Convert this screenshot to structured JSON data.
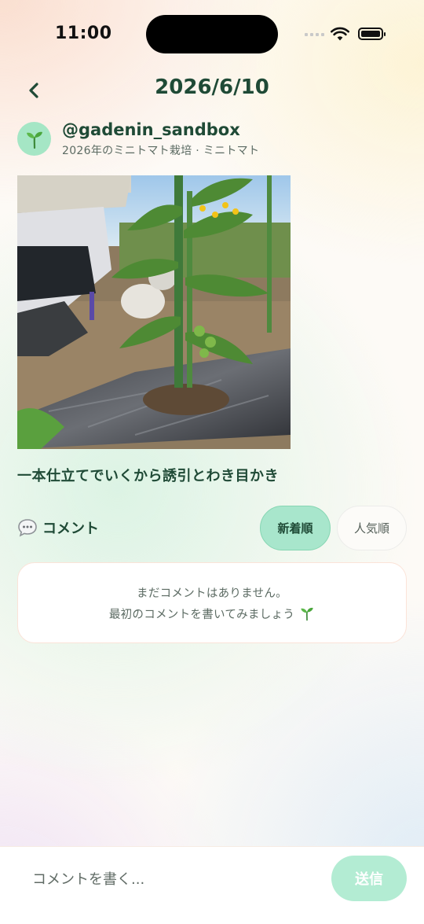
{
  "status_bar": {
    "time": "11:00"
  },
  "header": {
    "title": "2026/6/10",
    "back_icon": "chevron-left-icon"
  },
  "post": {
    "avatar_icon": "seedling-icon",
    "username": "@gadenin_sandbox",
    "subline": "2026年のミニトマト栽培 · ミニトマト",
    "photo_subject": "tomato-seedling-photo",
    "caption": "一本仕立てでいくから誘引とわき目かき"
  },
  "comments": {
    "icon": "speech-bubble-icon",
    "title": "コメント",
    "sort_options": [
      {
        "label": "新着順",
        "selected": true
      },
      {
        "label": "人気順",
        "selected": false
      }
    ],
    "empty_line1": "まだコメントはありません。",
    "empty_line2": "最初のコメントを書いてみましょう"
  },
  "composer": {
    "placeholder": "コメントを書く...",
    "send_label": "送信"
  },
  "colors": {
    "accent": "#a8e6cc",
    "text": "#1f4a36",
    "muted": "#5c6b63"
  }
}
